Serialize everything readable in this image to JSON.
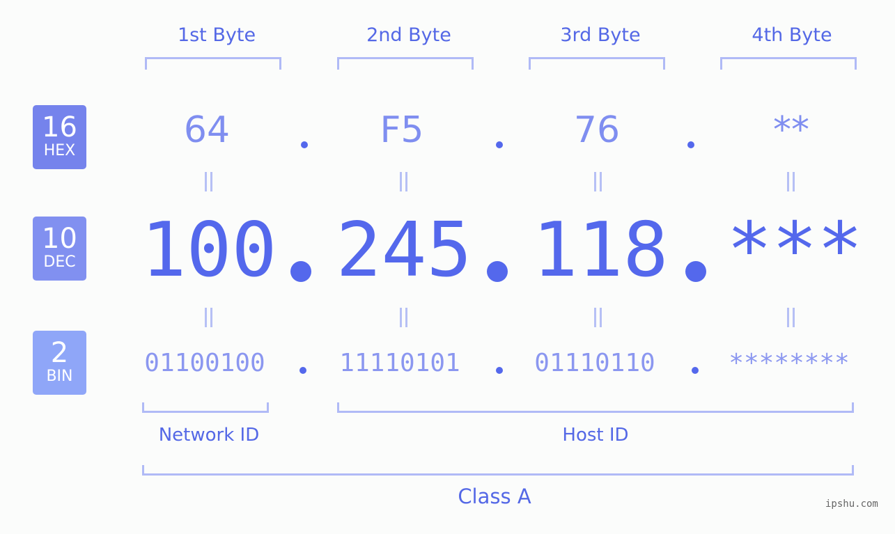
{
  "bytes": [
    {
      "header": "1st Byte",
      "hex": "64",
      "dec": "100",
      "bin": "01100100"
    },
    {
      "header": "2nd Byte",
      "hex": "F5",
      "dec": "245",
      "bin": "11110101"
    },
    {
      "header": "3rd Byte",
      "hex": "76",
      "dec": "118",
      "bin": "01110110"
    },
    {
      "header": "4th Byte",
      "hex": "**",
      "dec": "***",
      "bin": "********"
    }
  ],
  "bases": {
    "hex": {
      "number": "16",
      "label": "HEX",
      "color": "#7583ec"
    },
    "dec": {
      "number": "10",
      "label": "DEC",
      "color": "#8190f0"
    },
    "bin": {
      "number": "2",
      "label": "BIN",
      "color": "#8fa6f8"
    }
  },
  "groups": {
    "network": "Network ID",
    "host": "Host ID",
    "class": "Class A"
  },
  "watermark": "ipshu.com",
  "colors": {
    "accent": "#5468ec",
    "bracket": "#b0baf6",
    "hex_text": "#7f8ef0",
    "bin_text": "#8b97f0"
  }
}
